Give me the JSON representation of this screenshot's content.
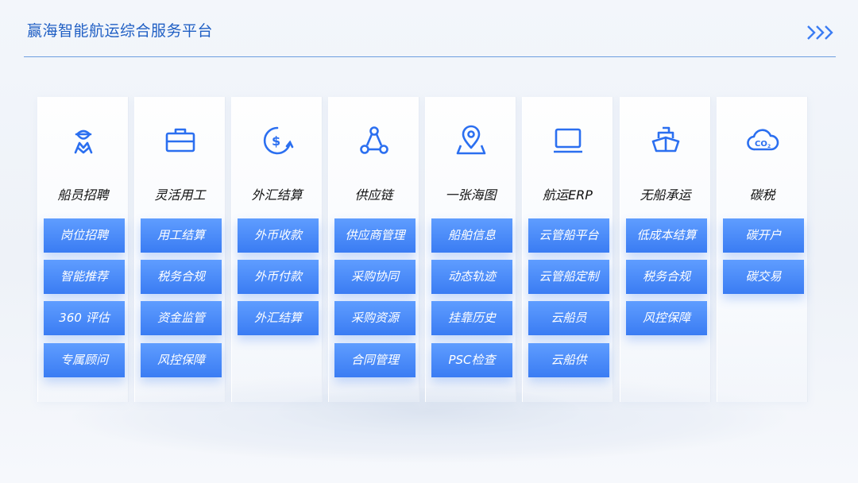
{
  "header": {
    "title": "赢海智能航运综合服务平台"
  },
  "columns": [
    {
      "title": "船员招聘",
      "icon": "crew-member-icon",
      "items": [
        "岗位招聘",
        "智能推荐",
        "360 评估",
        "专属顾问"
      ]
    },
    {
      "title": "灵活用工",
      "icon": "briefcase-icon",
      "items": [
        "用工结算",
        "税务合规",
        "资金监管",
        "风控保障"
      ]
    },
    {
      "title": "外汇结算",
      "icon": "dollar-exchange-icon",
      "items": [
        "外币收款",
        "外币付款",
        "外汇结算"
      ]
    },
    {
      "title": "供应链",
      "icon": "network-nodes-icon",
      "items": [
        "供应商管理",
        "采购协同",
        "采购资源",
        "合同管理"
      ]
    },
    {
      "title": "一张海图",
      "icon": "map-pin-icon",
      "items": [
        "船舶信息",
        "动态轨迹",
        "挂靠历史",
        "PSC检查"
      ]
    },
    {
      "title": "航运ERP",
      "icon": "laptop-icon",
      "items": [
        "云管船平台",
        "云管船定制",
        "云船员",
        "云船供"
      ]
    },
    {
      "title": "无船承运",
      "icon": "ship-icon",
      "items": [
        "低成本结算",
        "税务合规",
        "风控保障"
      ]
    },
    {
      "title": "碳税",
      "icon": "cloud-co2-icon",
      "items": [
        "碳开户",
        "碳交易"
      ]
    }
  ],
  "colors": {
    "accent": "#3a7cf3",
    "title": "#1f5fc4"
  }
}
